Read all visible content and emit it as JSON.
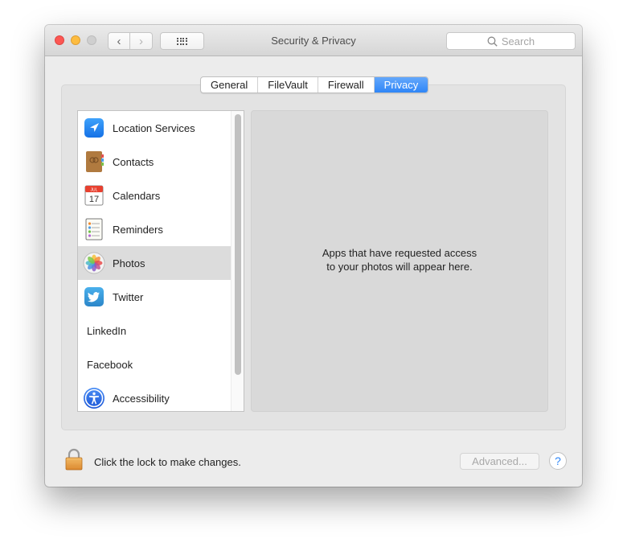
{
  "window": {
    "title": "Security & Privacy",
    "search_placeholder": "Search",
    "nav": {
      "back_icon": "‹",
      "forward_icon": "›"
    }
  },
  "tabs": [
    {
      "label": "General",
      "active": false
    },
    {
      "label": "FileVault",
      "active": false
    },
    {
      "label": "Firewall",
      "active": false
    },
    {
      "label": "Privacy",
      "active": true
    }
  ],
  "privacy_list": {
    "items": [
      {
        "label": "Location Services",
        "icon": "location-arrow-icon",
        "selected": false
      },
      {
        "label": "Contacts",
        "icon": "contacts-book-icon",
        "selected": false
      },
      {
        "label": "Calendars",
        "icon": "calendar-icon",
        "selected": false,
        "icon_text_month": "JUL",
        "icon_text_day": "17"
      },
      {
        "label": "Reminders",
        "icon": "reminders-icon",
        "selected": false
      },
      {
        "label": "Photos",
        "icon": "photos-icon",
        "selected": true
      },
      {
        "label": "Twitter",
        "icon": "twitter-icon",
        "selected": false
      },
      {
        "label": "LinkedIn",
        "icon": null,
        "selected": false
      },
      {
        "label": "Facebook",
        "icon": null,
        "selected": false
      },
      {
        "label": "Accessibility",
        "icon": "accessibility-icon",
        "selected": false
      }
    ]
  },
  "detail": {
    "message_line1": "Apps that have requested access",
    "message_line2": "to your photos will appear here."
  },
  "footer": {
    "lock_text": "Click the lock to make changes.",
    "advanced_label": "Advanced...",
    "help_label": "?"
  },
  "colors": {
    "accent": "#2f86f7",
    "close": "#fc5753",
    "minimize": "#fdbc40"
  }
}
